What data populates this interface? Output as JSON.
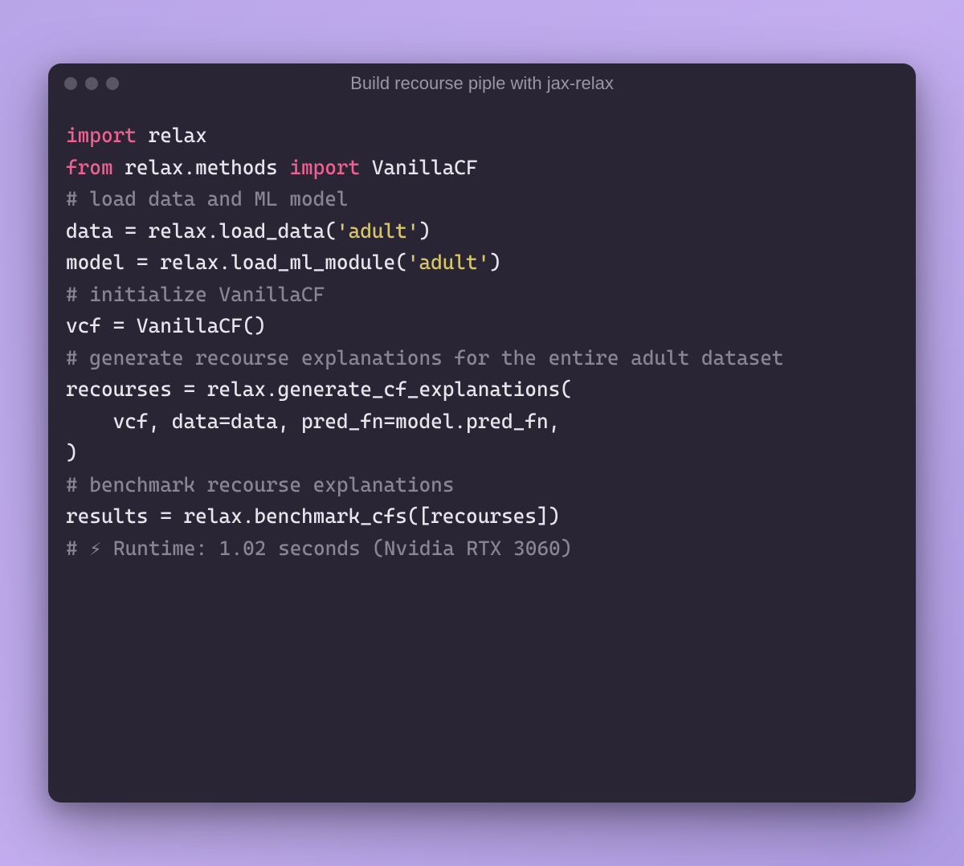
{
  "window": {
    "title": "Build recourse piple with jax-relax"
  },
  "code": {
    "l1_kw1": "import",
    "l1_id": " relax",
    "l2_kw1": "from",
    "l2_mod": " relax.methods ",
    "l2_kw2": "import",
    "l2_id": " VanillaCF",
    "blank": "",
    "l3_cm": "# load data and ML model",
    "l4_a": "data = relax.load_data(",
    "l4_str": "'adult'",
    "l4_b": ")",
    "l5_a": "model = relax.load_ml_module(",
    "l5_str": "'adult'",
    "l5_b": ")",
    "l6_cm": "# initialize VanillaCF",
    "l7": "vcf = VanillaCF()",
    "l8_cm": "# generate recourse explanations for the entire adult dataset",
    "l9": "recourses = relax.generate_cf_explanations(",
    "l10": "    vcf, data=data, pred_fn=model.pred_fn,",
    "l11": ")",
    "l12_cm": "# benchmark recourse explanations",
    "l13": "results = relax.benchmark_cfs([recourses])",
    "l14_cm": "# ⚡ Runtime: 1.02 seconds (Nvidia RTX 3060)"
  }
}
